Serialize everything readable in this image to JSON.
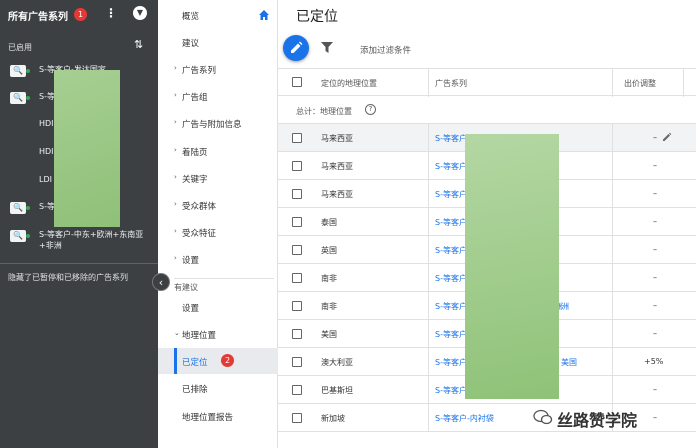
{
  "left_panel": {
    "title": "所有广告系列",
    "title_badge": "1",
    "section_enabled": "已启用",
    "items": [
      {
        "label": "S-等客户-发达国家"
      },
      {
        "label": "S-等客户-东南亚"
      },
      {
        "label": "HDI"
      },
      {
        "label": "HDI"
      },
      {
        "label": "LDI"
      },
      {
        "label": "S-等客户-拉美"
      },
      {
        "label": "S-等客户-中东+欧洲+东南亚+非洲"
      }
    ],
    "hidden_note": "隐藏了已暂停和已移除的广告系列"
  },
  "nav": {
    "items": [
      {
        "label": "概览"
      },
      {
        "label": "建议"
      },
      {
        "label": "广告系列"
      },
      {
        "label": "广告组"
      },
      {
        "label": "广告与附加信息"
      },
      {
        "label": "着陆页"
      },
      {
        "label": "关键字"
      },
      {
        "label": "受众群体"
      },
      {
        "label": "受众特征"
      },
      {
        "label": "设置"
      }
    ],
    "section": "有建议",
    "settings": "设置",
    "geo": "地理位置",
    "targeted": "已定位",
    "targeted_badge": "2",
    "excluded": "已排除",
    "geo_report": "地理位置报告"
  },
  "main": {
    "title": "已定位",
    "add_filter": "添加过滤条件",
    "columns": {
      "location": "定位的地理位置",
      "campaign": "广告系列",
      "bid_adj": "出价调整"
    },
    "total_label": "总计：地理位置",
    "rows": [
      {
        "location": "马来西亚",
        "campaign": "S-等客户-东南亚",
        "campaign_tail": "",
        "bid": "–"
      },
      {
        "location": "马来西亚",
        "campaign": "S-等客户-东南亚",
        "campaign_tail": "",
        "bid": "–"
      },
      {
        "location": "马来西亚",
        "campaign": "S-等客户-东南亚",
        "campaign_tail": "",
        "bid": "–"
      },
      {
        "location": "泰国",
        "campaign": "S-等客户-东南亚",
        "campaign_tail": "",
        "bid": "–"
      },
      {
        "location": "英国",
        "campaign": "S-等客户-发达国家",
        "campaign_tail": "",
        "bid": "–"
      },
      {
        "location": "南非",
        "campaign": "S-等客户-东南亚",
        "campaign_tail": "",
        "bid": "–"
      },
      {
        "location": "南非",
        "campaign": "S-等客户-中东+欧洲+东南亚+非洲",
        "campaign_tail": "洲",
        "bid": "–"
      },
      {
        "location": "美国",
        "campaign": "S-等客户-发达国家",
        "campaign_tail": "",
        "bid": "–"
      },
      {
        "location": "澳大利亚",
        "campaign": "S-等客户-发达国家",
        "campaign_tail": "美国",
        "bid": "+5%"
      },
      {
        "location": "巴基斯坦",
        "campaign": "S-等客户-南亚",
        "campaign_tail": "",
        "bid": "–"
      },
      {
        "location": "新加坡",
        "campaign": "S-等客户-内衬袋",
        "campaign_tail": "",
        "bid": "–"
      }
    ]
  },
  "watermark": "丝路赞学院"
}
